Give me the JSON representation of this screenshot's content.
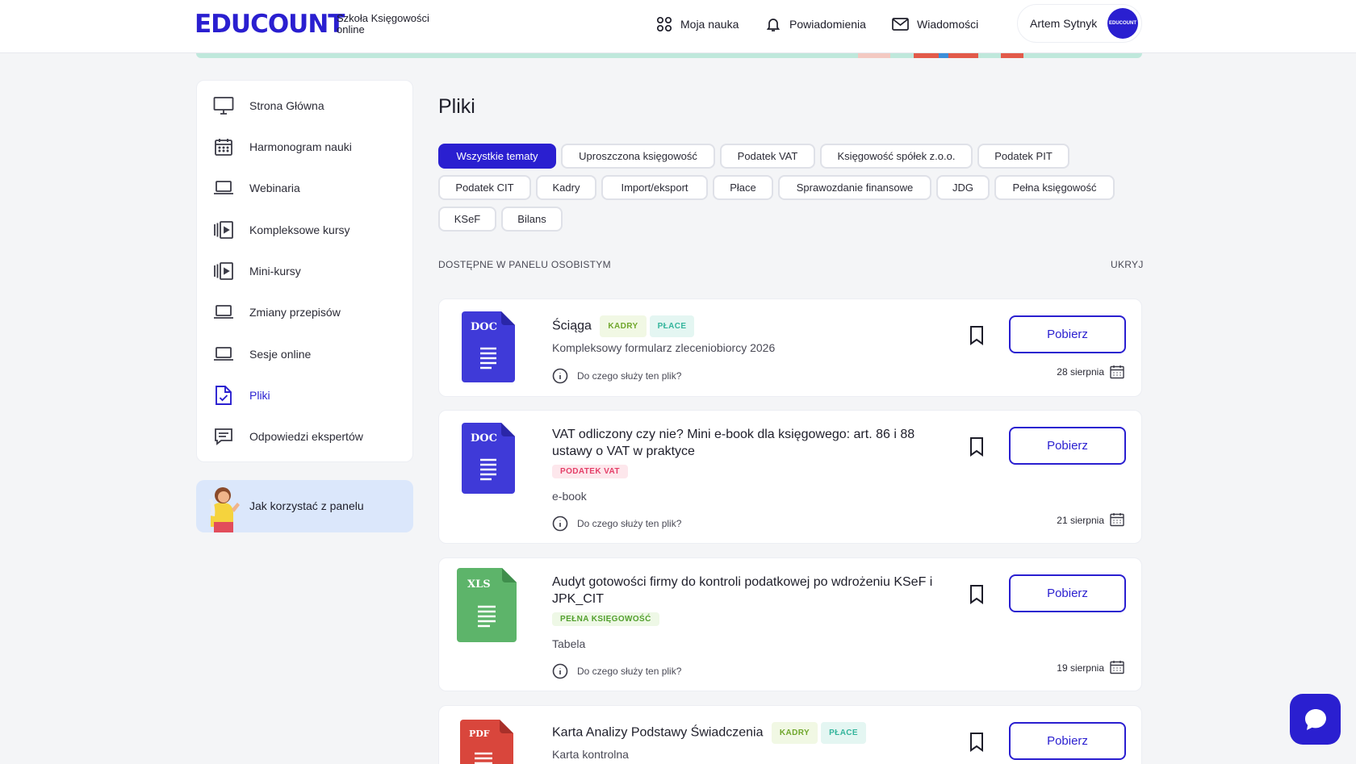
{
  "header": {
    "logo": "EDUCOUNT",
    "logo_sub": "Szkoła Księgowości online",
    "nav": [
      {
        "label": "Moja nauka",
        "icon": "grid-icon"
      },
      {
        "label": "Powiadomienia",
        "icon": "bell-icon"
      },
      {
        "label": "Wiadomości",
        "icon": "mail-icon"
      }
    ],
    "user_name": "Artem Sytnyk",
    "avatar_text": "EDUCOUNT"
  },
  "sidebar": {
    "items": [
      {
        "label": "Strona Główna",
        "icon": "monitor-icon"
      },
      {
        "label": "Harmonogram nauki",
        "icon": "calendar-icon"
      },
      {
        "label": "Webinaria",
        "icon": "laptop-icon"
      },
      {
        "label": "Kompleksowe kursy",
        "icon": "video-stack-icon"
      },
      {
        "label": "Mini-kursy",
        "icon": "video-stack-icon"
      },
      {
        "label": "Zmiany przepisów",
        "icon": "laptop-icon"
      },
      {
        "label": "Sesje online",
        "icon": "laptop-icon"
      },
      {
        "label": "Pliki",
        "icon": "file-check-icon",
        "active": true
      },
      {
        "label": "Odpowiedzi ekspertów",
        "icon": "chat-lines-icon"
      }
    ],
    "help_label": "Jak korzystać z panelu"
  },
  "main": {
    "title": "Pliki",
    "filters": [
      "Wszystkie tematy",
      "Uproszczona księgowość",
      "Podatek VAT",
      "Księgowość spółek z.o.o.",
      "Podatek PIT",
      "Podatek CIT",
      "Kadry",
      "Import/eksport",
      "Płace",
      "Sprawozdanie finansowe",
      "JDG",
      "Pełna księgowość",
      "KSeF",
      "Bilans"
    ],
    "active_filter": "Wszystkie tematy",
    "section_label": "DOSTĘPNE W PANELU OSOBISTYM",
    "hide_label": "UKRYJ",
    "info_label": "Do czego służy ten plik?",
    "download_label": "Pobierz",
    "files": [
      {
        "type": "DOC",
        "title": "Ściąga",
        "tags": [
          "KADRY",
          "PŁACE"
        ],
        "subtitle": "Kompleksowy formularz zleceniobiorcy 2026",
        "date": "28 sierpnia"
      },
      {
        "type": "DOC",
        "title": "VAT odliczony czy nie? Mini e-book dla księgowego: art. 86 i 88 ustawy o VAT w praktyce",
        "tags": [
          "PODATEK VAT"
        ],
        "subtitle": "e-book",
        "date": "21 sierpnia"
      },
      {
        "type": "XLS",
        "title": "Audyt gotowości firmy do kontroli podatkowej po wdrożeniu KSeF i JPK_CIT",
        "tags": [
          "PEŁNA KSIĘGOWOŚĆ"
        ],
        "subtitle": "Tabela",
        "date": "19 sierpnia"
      },
      {
        "type": "PDF",
        "title": "Karta Analizy Podstawy Świadczenia",
        "tags": [
          "KADRY",
          "PŁACE"
        ],
        "subtitle": "Karta kontrolna",
        "date": ""
      }
    ]
  },
  "colors": {
    "brand": "#2a1fd0",
    "doc": "#3f3ad8",
    "xls": "#5db46a",
    "pdf": "#d9463c"
  }
}
